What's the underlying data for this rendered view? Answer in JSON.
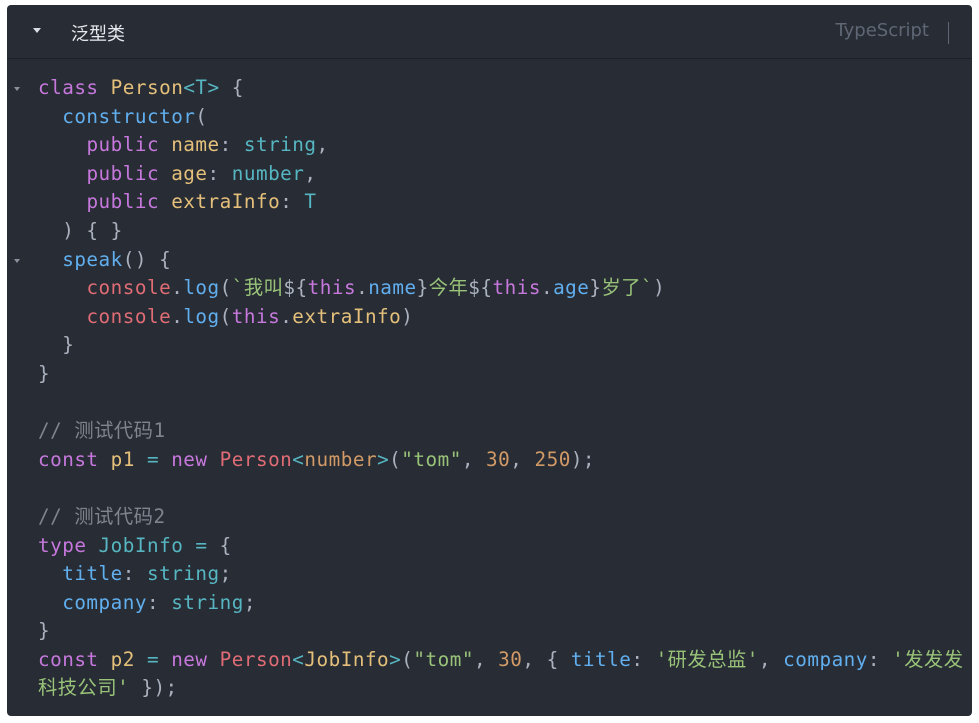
{
  "header": {
    "title": "泛型类",
    "language": "TypeScript"
  },
  "code_lines": [
    "class Person<T> {",
    "  constructor(",
    "    public name: string,",
    "    public age: number,",
    "    public extraInfo: T",
    "  ) { }",
    "  speak() {",
    "    console.log(`我叫${this.name}今年${this.age}岁了`)",
    "    console.log(this.extraInfo)",
    "  }",
    "}",
    "",
    "// 测试代码1",
    "const p1 = new Person<number>(\"tom\", 30, 250);",
    "",
    "// 测试代码2",
    "type JobInfo = {",
    "  title: string;",
    "  company: string;",
    "}",
    "const p2 = new Person<JobInfo>(\"tom\", 30, { title: '研发总监', company: '发发发",
    "科技公司' });"
  ],
  "colors": {
    "background": "#282c34",
    "keyword": "#c678dd",
    "function": "#61afef",
    "class": "#e5c07b",
    "type": "#56b6c2",
    "string": "#98c379",
    "number": "#d19a66",
    "comment": "#7f848e",
    "object": "#e06c75"
  },
  "icons": {
    "header_toggle": "caret-down-icon",
    "fold_marker": "fold-caret-icon"
  }
}
